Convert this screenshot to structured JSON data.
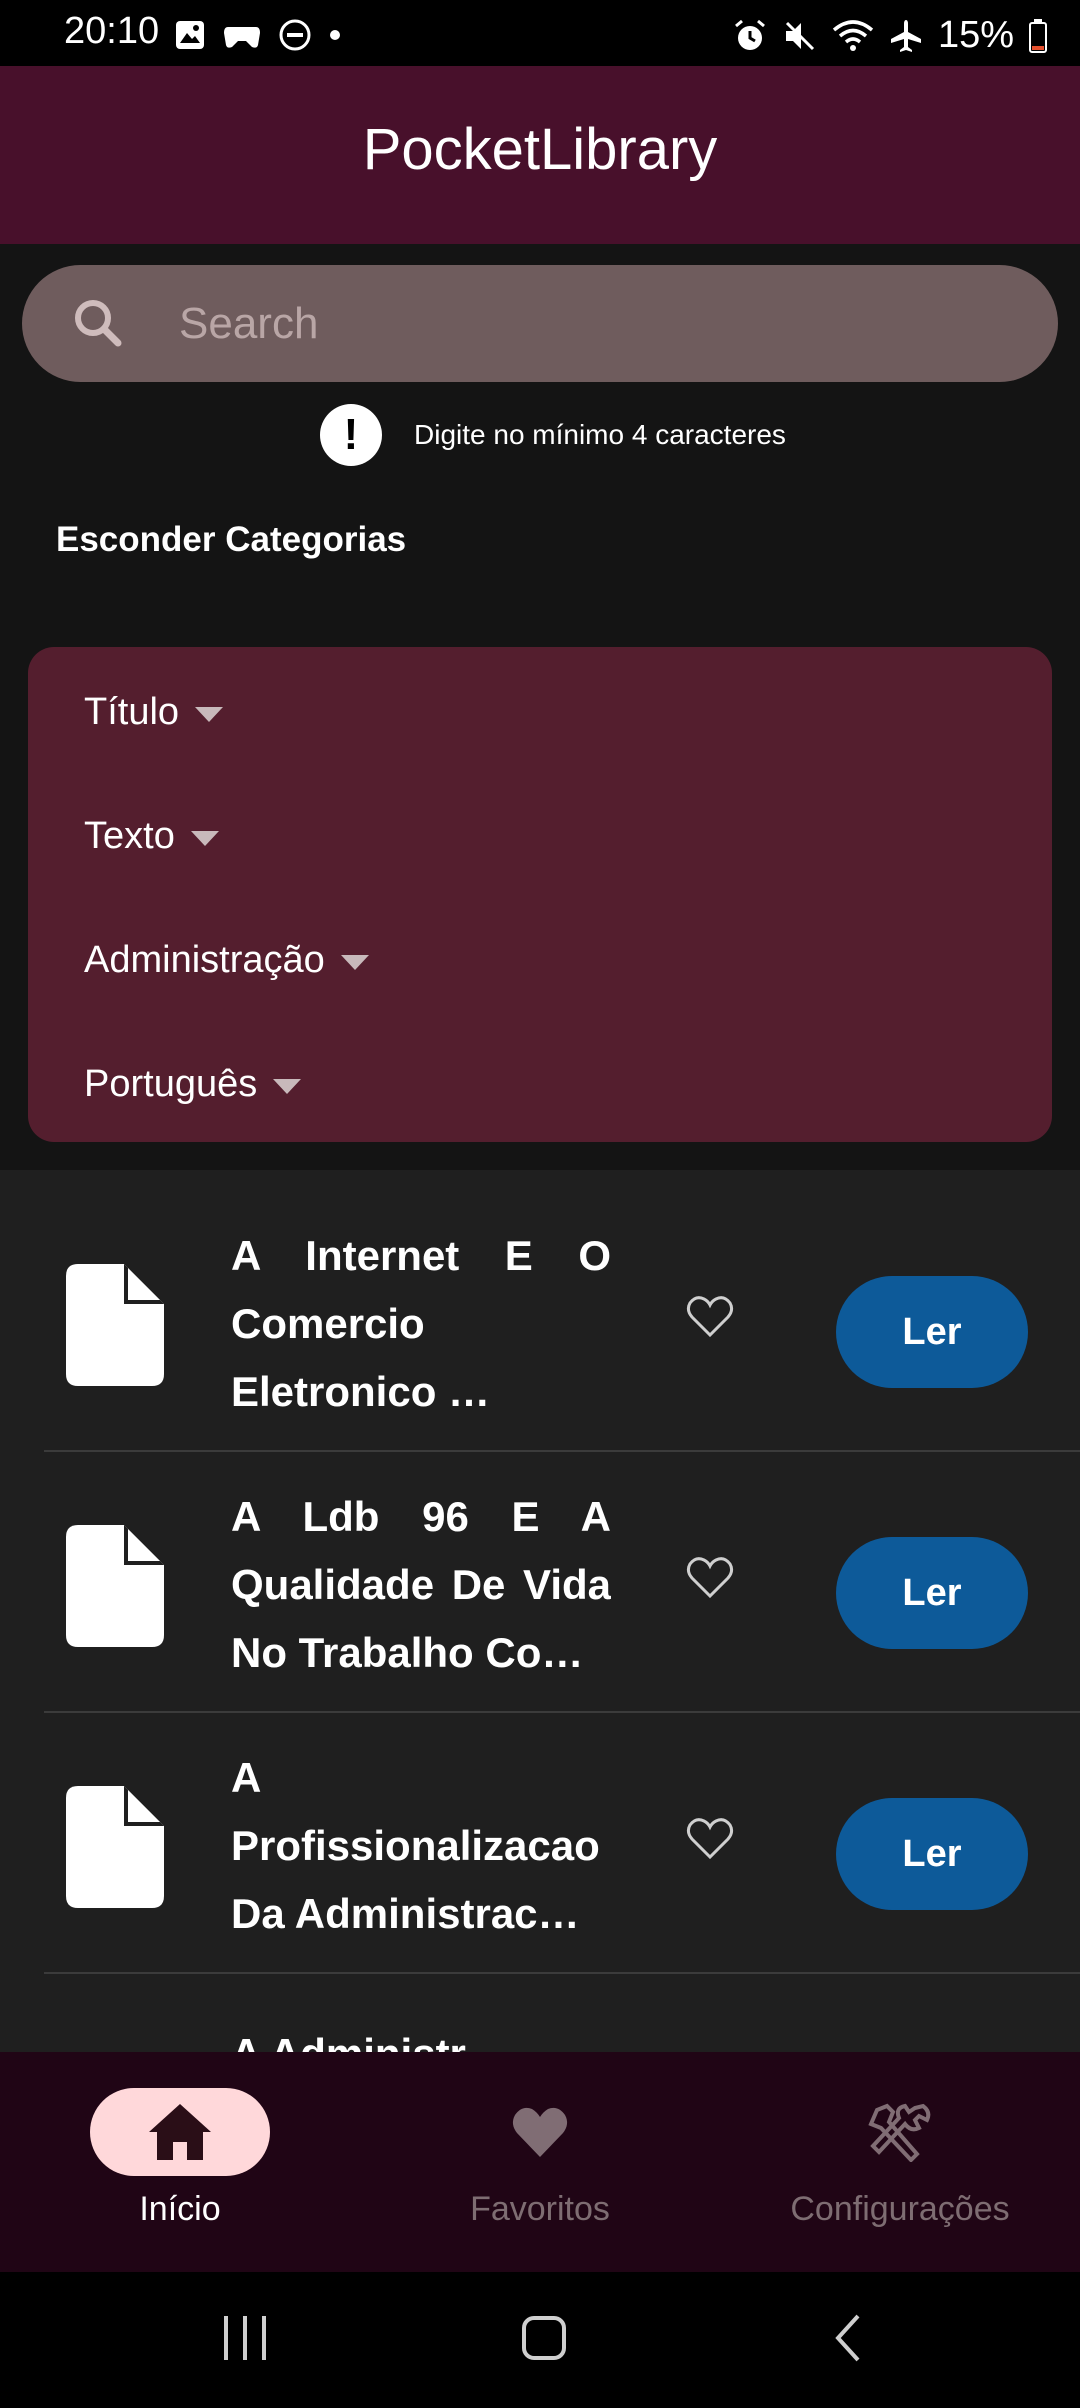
{
  "status_bar": {
    "time": "20:10",
    "battery": "15%",
    "icons_left": [
      "image-icon",
      "game-icon",
      "dnd-icon",
      "dot-icon"
    ],
    "icons_right": [
      "alarm-icon",
      "mute-icon",
      "wifi-icon",
      "airplane-icon",
      "battery-icon"
    ]
  },
  "app_bar": {
    "title": "PocketLibrary",
    "background": "#48102b"
  },
  "search": {
    "placeholder": "Search",
    "value": "",
    "hint": "Digite no mínimo 4 caracteres",
    "hint_icon": "exclamation-icon"
  },
  "categories_toggle": "Esconder Categorias",
  "filters": [
    {
      "label": "Título"
    },
    {
      "label": "Texto"
    },
    {
      "label": "Administração"
    },
    {
      "label": "Português"
    }
  ],
  "list": {
    "items": [
      {
        "title": "A Internet E O Comercio Eletronico …",
        "button": "Ler"
      },
      {
        "title": "A Ldb 96 E A Qualidade De Vida No Trabalho Co…",
        "button": "Ler"
      },
      {
        "title": "A Profissionalizacao Da Administrac…",
        "button": "Ler"
      }
    ],
    "partial_item_title": "A Administr"
  },
  "bottom_nav": [
    {
      "label": "Início",
      "icon": "home-icon",
      "active": true
    },
    {
      "label": "Favoritos",
      "icon": "heart-icon",
      "active": false
    },
    {
      "label": "Configurações",
      "icon": "tools-icon",
      "active": false
    }
  ],
  "colors": {
    "accent_button": "#0d5a99",
    "filter_card": "#541e2e",
    "nav_active": "#ffd8da"
  }
}
